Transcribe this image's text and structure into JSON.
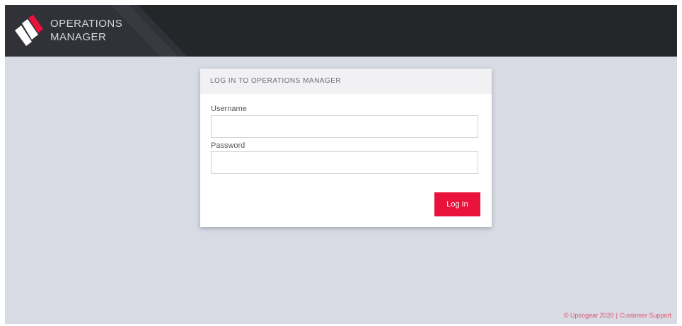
{
  "header": {
    "brand_line1": "OPERATIONS",
    "brand_line2": "MANAGER",
    "logo_icon": "operations-manager-logo"
  },
  "login": {
    "title": "LOG IN TO OPERATIONS MANAGER",
    "username_label": "Username",
    "username_value": "",
    "password_label": "Password",
    "password_value": "",
    "submit_label": "Log In"
  },
  "footer": {
    "copyright": "© Upsogear 2020",
    "separator": "|",
    "support_link": "Customer Support"
  },
  "colors": {
    "header_bg": "#25262a",
    "page_bg": "#d8dae4",
    "accent": "#e8123a",
    "footer_text": "#e0566f"
  }
}
